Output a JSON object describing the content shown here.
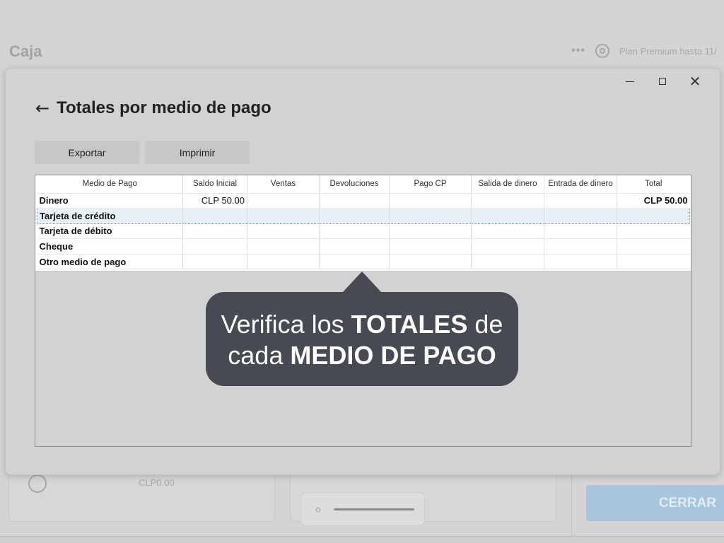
{
  "app": {
    "title": "Caja",
    "more_icon": "•••",
    "plan_text": "Plan Premium hasta 11/",
    "bottom_amount": "CLP0.00",
    "close_button": "CERRAR"
  },
  "window": {
    "minimize_icon": "minimize-icon",
    "maximize_icon": "maximize-icon",
    "close_icon": "close-icon",
    "close_glyph": "✕"
  },
  "dialog": {
    "back_glyph": "←",
    "title": "Totales por medio de pago",
    "export_label": "Exportar",
    "print_label": "Imprimir"
  },
  "table": {
    "columns": [
      "Medio de Pago",
      "Saldo Inicial",
      "Ventas",
      "Devoluciones",
      "Pago CP",
      "Salida de dinero",
      "Entrada de dinero",
      "Total"
    ],
    "rows": [
      {
        "medio": "Dinero",
        "saldo": "CLP 50.00",
        "ventas": "",
        "devoluciones": "",
        "pago_cp": "",
        "salida": "",
        "entrada": "",
        "total": "CLP 50.00"
      },
      {
        "medio": "Tarjeta de crédito",
        "saldo": "",
        "ventas": "",
        "devoluciones": "",
        "pago_cp": "",
        "salida": "",
        "entrada": "",
        "total": ""
      },
      {
        "medio": "Tarjeta de débito",
        "saldo": "",
        "ventas": "",
        "devoluciones": "",
        "pago_cp": "",
        "salida": "",
        "entrada": "",
        "total": ""
      },
      {
        "medio": "Cheque",
        "saldo": "",
        "ventas": "",
        "devoluciones": "",
        "pago_cp": "",
        "salida": "",
        "entrada": "",
        "total": ""
      },
      {
        "medio": "Otro medio de pago",
        "saldo": "",
        "ventas": "",
        "devoluciones": "",
        "pago_cp": "",
        "salida": "",
        "entrada": "",
        "total": ""
      }
    ]
  },
  "callout": {
    "line1_a": "Verifica los ",
    "line1_b": "TOTALES",
    "line1_c": " de",
    "line2_a": "cada ",
    "line2_b": "MEDIO DE PAGO"
  },
  "colors": {
    "callout_bg": "#474953",
    "selected_row": "#e9f1f8",
    "close_button": "#a9c4dd"
  }
}
